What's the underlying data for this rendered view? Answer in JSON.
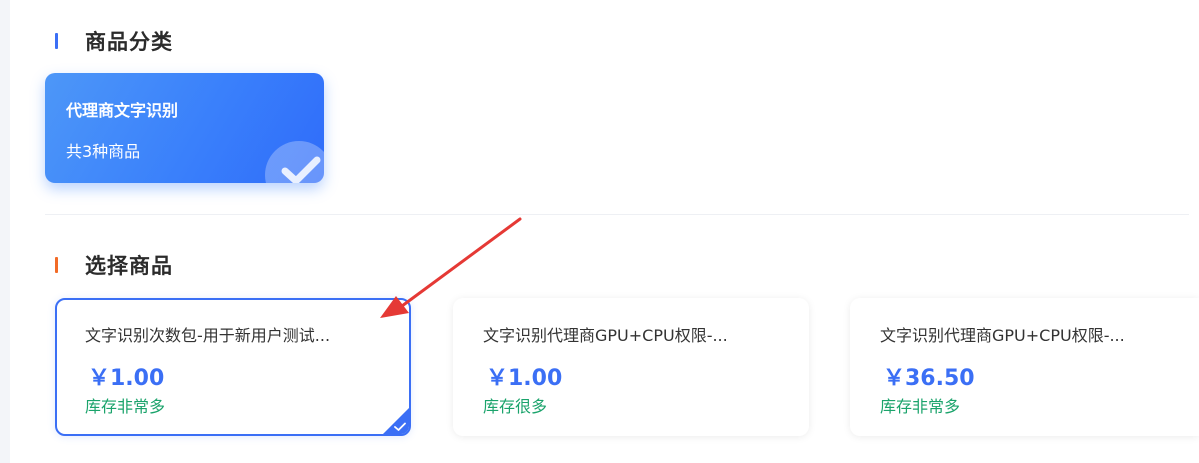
{
  "colors": {
    "accent": "#3b6ff5",
    "stock_green": "#1aa36b",
    "title_bar_blue": "#3b6ff5",
    "title_bar_orange": "#f26b27",
    "annotation_red": "#e53935"
  },
  "category_section": {
    "title": "商品分类",
    "cards": [
      {
        "name": "代理商文字识别",
        "count": "共3种商品",
        "icon": "check-icon"
      }
    ]
  },
  "product_section": {
    "title": "选择商品",
    "products": [
      {
        "name": "文字识别次数包-用于新用户测试...",
        "price": "￥1.00",
        "stock": "库存非常多",
        "selected": true
      },
      {
        "name": "文字识别代理商GPU+CPU权限-...",
        "price": "￥1.00",
        "stock": "库存很多",
        "selected": false
      },
      {
        "name": "文字识别代理商GPU+CPU权限-...",
        "price": "￥36.50",
        "stock": "库存非常多",
        "selected": false
      }
    ]
  }
}
